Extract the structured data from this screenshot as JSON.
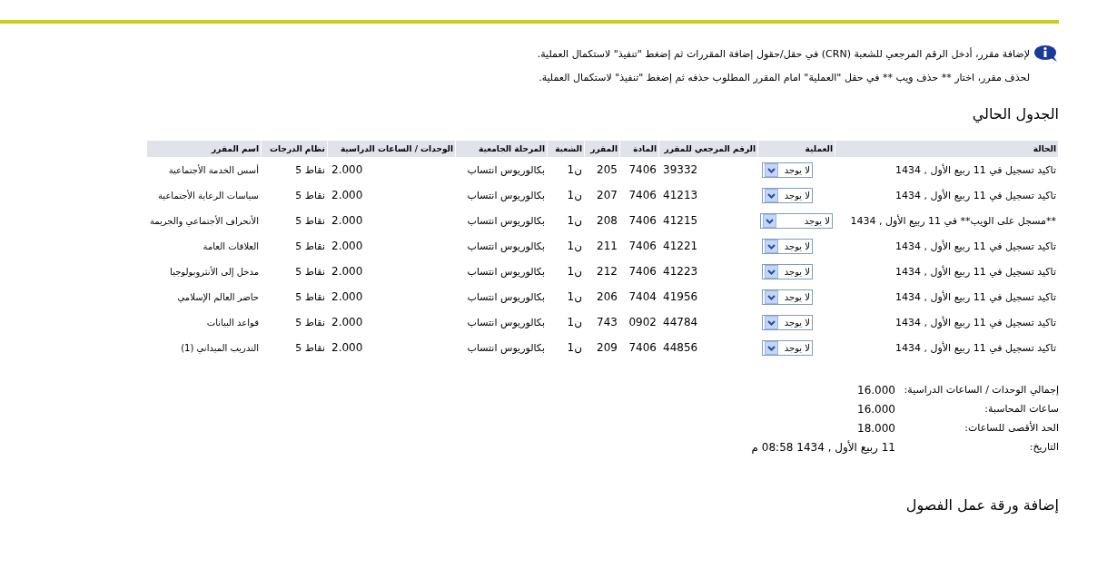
{
  "instructions": [
    "لإضافة مقرر، أدخل الرقم المرجعي للشعبة (CRN) في حقل/حقول إضافة المقررات ثم إضغط \"تنفيذ\" لاستكمال العملية.",
    "لحذف مقرر، اختار ** حذف ويب ** في حقل \"العملية\" امام المقرر المطلوب حذفه ثم إضغط \"تنفيذ\" لاستكمال العملية."
  ],
  "schedule": {
    "title": "الجدول الحالي",
    "columns": [
      "الحالة",
      "العملية",
      "الرقم المرجعي للمقرر",
      "المادة",
      "المقرر",
      "الشعبة",
      "المرحلة الجامعية",
      "الوحدات / الساعات الدراسية",
      "نظام الدرجات",
      "اسم المقرر"
    ],
    "rows": [
      {
        "status": "تاكيد تسجيل في 11 ربيع الأول , 1434",
        "action": "لا يوجد",
        "crn": "39332",
        "subject": "7406",
        "course": "205",
        "section": "ن1",
        "level": "بكالوريوس انتساب",
        "units": "2.000",
        "grading": "نقاط 5",
        "title": "أسس الخدمة الأجتماعية"
      },
      {
        "status": "تاكيد تسجيل في 11 ربيع الأول , 1434",
        "action": "لا يوجد",
        "crn": "41213",
        "subject": "7406",
        "course": "207",
        "section": "ن1",
        "level": "بكالوريوس انتساب",
        "units": "2.000",
        "grading": "نقاط 5",
        "title": "سياسات الرعاية الأجتماعية"
      },
      {
        "status": "**مسجل على الويب** في 11 ربيع الأول , 1434",
        "action": "لا يوجد",
        "crn": "41215",
        "subject": "7406",
        "course": "208",
        "section": "ن1",
        "level": "بكالوريوس انتساب",
        "units": "2.000",
        "grading": "نقاط 5",
        "title": "الأنحراف الأجتماعي والجريمة"
      },
      {
        "status": "تاكيد تسجيل في 11 ربيع الأول , 1434",
        "action": "لا يوجد",
        "crn": "41221",
        "subject": "7406",
        "course": "211",
        "section": "ن1",
        "level": "بكالوريوس انتساب",
        "units": "2.000",
        "grading": "نقاط 5",
        "title": "العلاقات العامة"
      },
      {
        "status": "تاكيد تسجيل في 11 ربيع الأول , 1434",
        "action": "لا يوجد",
        "crn": "41223",
        "subject": "7406",
        "course": "212",
        "section": "ن1",
        "level": "بكالوريوس انتساب",
        "units": "2.000",
        "grading": "نقاط 5",
        "title": "مدخل إلى الأنثروبولوجيا"
      },
      {
        "status": "تاكيد تسجيل في 11 ربيع الأول , 1434",
        "action": "لا يوجد",
        "crn": "41956",
        "subject": "7404",
        "course": "206",
        "section": "ن1",
        "level": "بكالوريوس انتساب",
        "units": "2.000",
        "grading": "نقاط 5",
        "title": "حاضر العالم الإسلامي"
      },
      {
        "status": "تاكيد تسجيل في 11 ربيع الأول , 1434",
        "action": "لا يوجد",
        "crn": "44784",
        "subject": "0902",
        "course": "743",
        "section": "ن1",
        "level": "بكالوريوس انتساب",
        "units": "2.000",
        "grading": "نقاط 5",
        "title": "قواعد البيانات"
      },
      {
        "status": "تاكيد تسجيل في 11 ربيع الأول , 1434",
        "action": "لا يوجد",
        "crn": "44856",
        "subject": "7406",
        "course": "209",
        "section": "ن1",
        "level": "بكالوريوس انتساب",
        "units": "2.000",
        "grading": "نقاط 5",
        "title": "التدريب الميداني (1)"
      }
    ]
  },
  "summary": [
    {
      "label": "إجمالي الوحدات / الساعات الدراسية:",
      "value": "16.000"
    },
    {
      "label": "ساعات المحاسبة:",
      "value": "16.000"
    },
    {
      "label": "الحد الأقصى للساعات:",
      "value": "18.000"
    },
    {
      "label": "التاريخ:",
      "value": "11 ربيع الأول , 1434 08:58 م"
    }
  ],
  "add_section": {
    "title": "إضافة ورقة عمل الفصول"
  }
}
